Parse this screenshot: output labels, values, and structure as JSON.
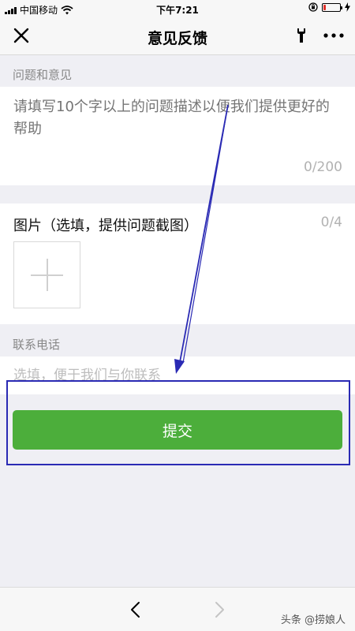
{
  "status_bar": {
    "carrier": "中国移动",
    "time": "下午7:21",
    "battery_level": 0.15,
    "battery_color": "#e0312b"
  },
  "nav": {
    "title": "意见反馈",
    "close_icon": "close-icon",
    "tool_icon": "wrench-icon",
    "more_icon": "more-icon"
  },
  "feedback": {
    "section_label": "问题和意见",
    "placeholder": "请填写10个字以上的问题描述以便我们提供更好的帮助",
    "counter": "0/200"
  },
  "images": {
    "title": "图片（选填，提供问题截图）",
    "counter": "0/4",
    "add_icon": "plus-icon"
  },
  "contact": {
    "section_label": "联系电话",
    "placeholder": "选填，便于我们与你联系"
  },
  "submit": {
    "label": "提交",
    "color": "#4cae3b"
  },
  "annotation": {
    "color": "#2a2ab4"
  },
  "bottom_bar": {
    "back_icon": "chevron-left-icon",
    "forward_icon": "chevron-right-icon"
  },
  "watermark": "头条 @捞娘人"
}
